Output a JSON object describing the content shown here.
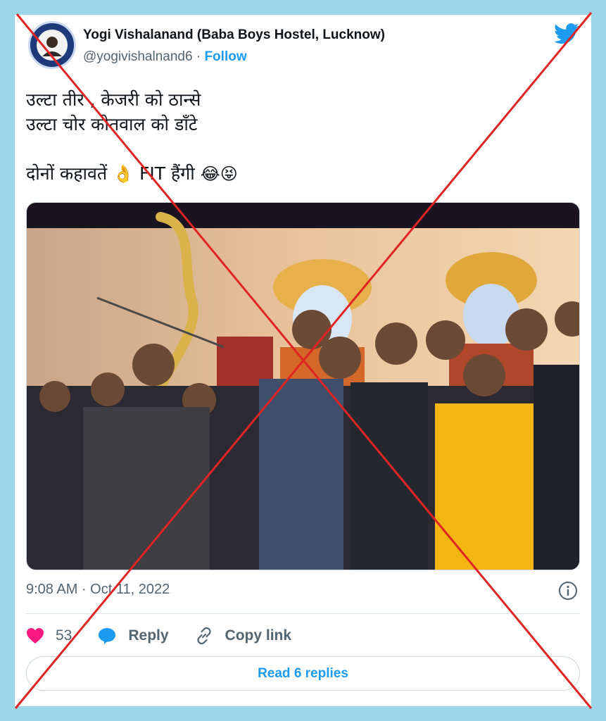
{
  "author": {
    "name": "Yogi Vishalanand (Baba Boys Hostel, Lucknow)",
    "handle": "@yogivishalnand6",
    "separator": "·",
    "follow_label": "Follow"
  },
  "tweet": {
    "line1": "उल्टा तीर , केजरी को ठान्से",
    "line2": "उल्टा चोर कोतवाल को डाँटे",
    "line3_text": "दोनों कहावतें",
    "line3_emoji1": "👌",
    "line3_fit": "FIT हैंगी",
    "line3_emoji2": "😂😝"
  },
  "timestamp": "9:08 AM · Oct 11, 2022",
  "actions": {
    "like_count": "53",
    "reply_label": "Reply",
    "copy_label": "Copy link"
  },
  "read_replies_label": "Read 6 replies",
  "colors": {
    "background": "#9bd7e8",
    "twitter_blue": "#1d9bf0",
    "like_pink": "#f91880",
    "cross_red": "#e02424"
  },
  "icons": [
    "twitter-bird-icon",
    "info-icon",
    "heart-icon",
    "reply-bubble-icon",
    "link-icon"
  ]
}
